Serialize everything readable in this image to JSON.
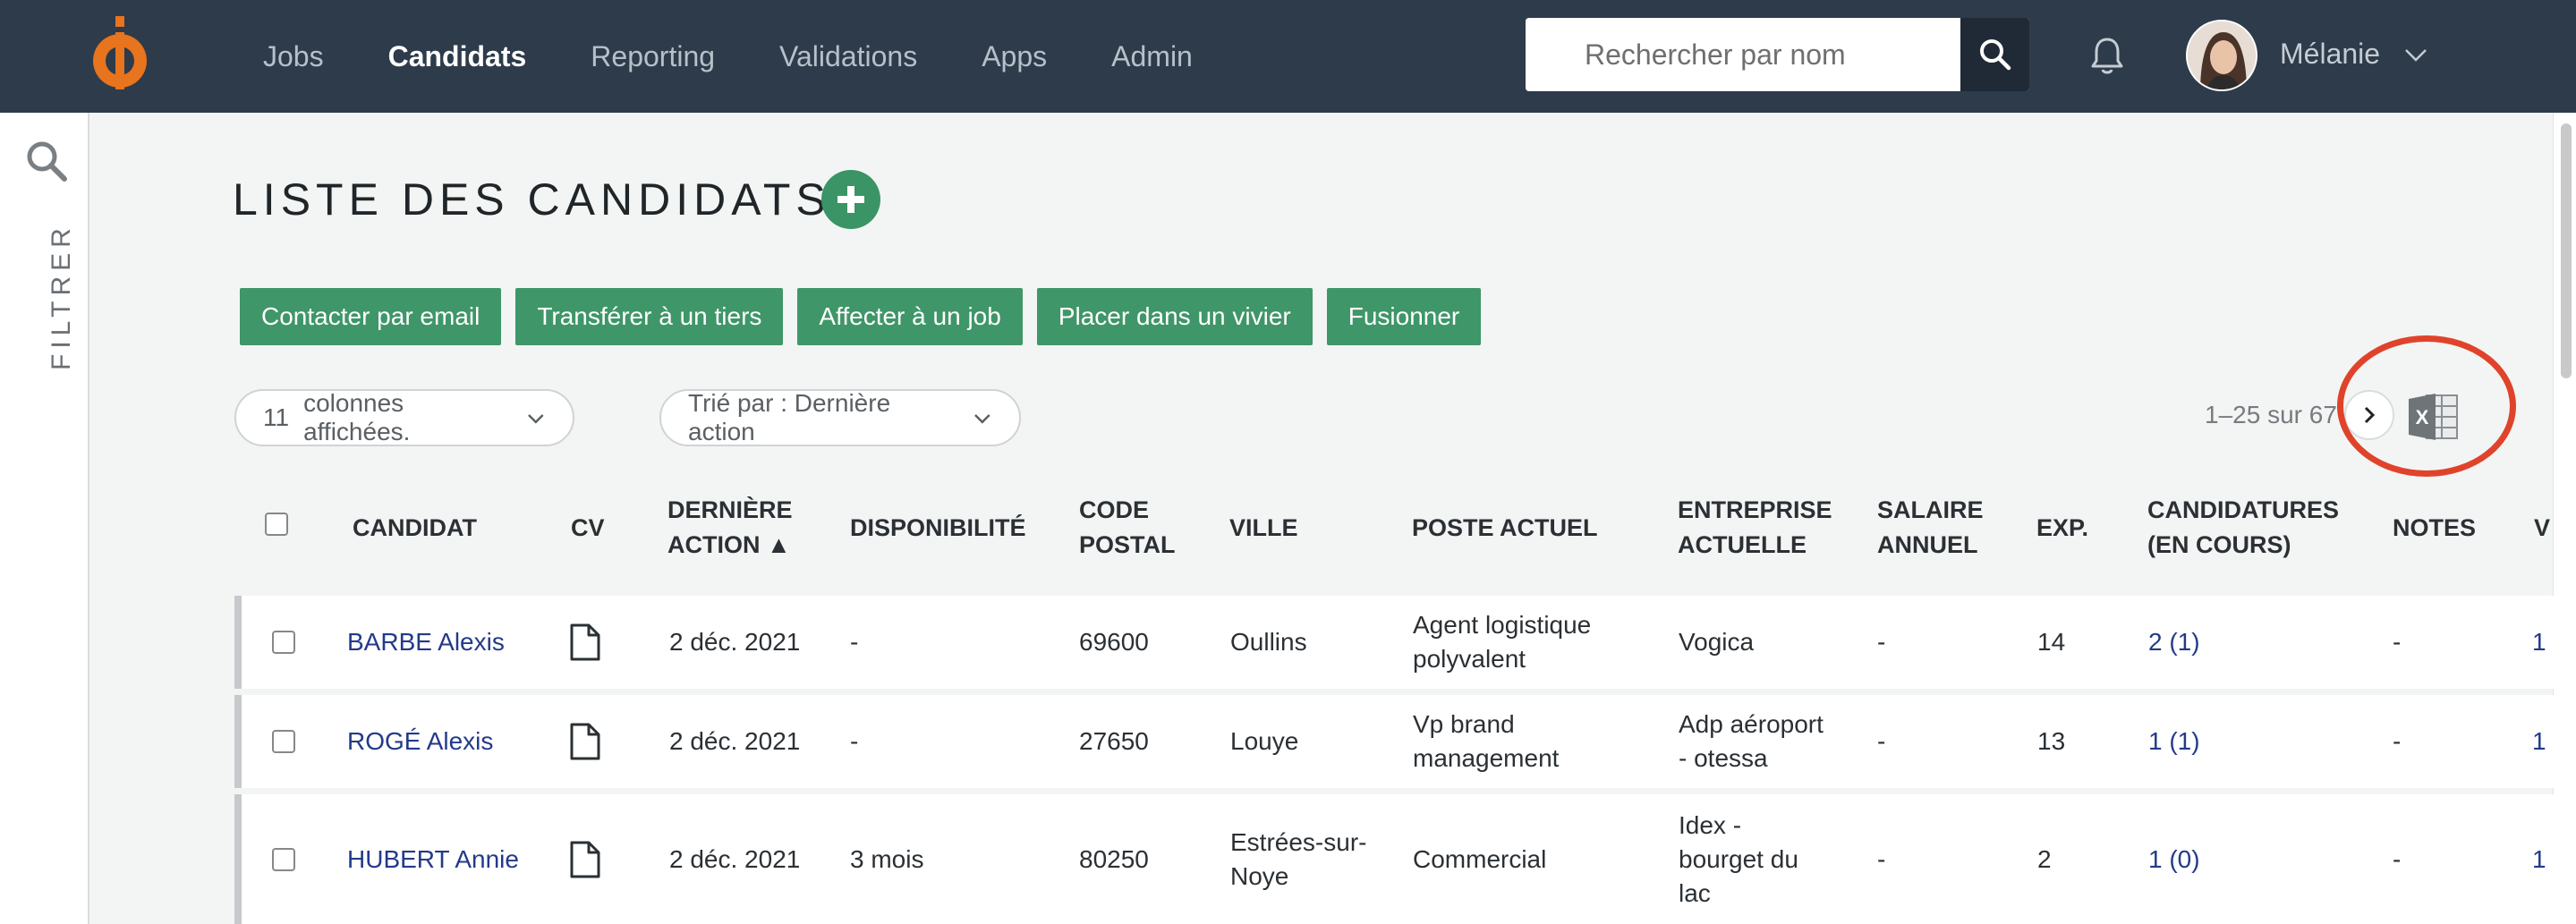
{
  "nav": {
    "items": [
      "Jobs",
      "Candidats",
      "Reporting",
      "Validations",
      "Apps",
      "Admin"
    ],
    "active": "Candidats"
  },
  "search": {
    "placeholder": "Rechercher par nom"
  },
  "user": {
    "name": "Mélanie"
  },
  "filter": {
    "label": "FILTRER"
  },
  "page": {
    "title": "LISTE DES CANDIDATS"
  },
  "actions": [
    "Contacter par email",
    "Transférer à un tiers",
    "Affecter à un job",
    "Placer dans un vivier",
    "Fusionner"
  ],
  "toolbar": {
    "columns_count": "11",
    "columns_label": "colonnes affichées.",
    "sort_label": "Trié par : Dernière action",
    "pagination": "1–25 sur 67"
  },
  "table": {
    "headers": {
      "candidat": "CANDIDAT",
      "cv": "CV",
      "derniere_1": "DERNIÈRE",
      "derniere_2": "ACTION ▲",
      "disponibilite": "DISPONIBILITÉ",
      "code_1": "CODE",
      "code_2": "POSTAL",
      "ville": "VILLE",
      "poste": "POSTE ACTUEL",
      "entreprise_1": "ENTREPRISE",
      "entreprise_2": "ACTUELLE",
      "salaire_1": "SALAIRE",
      "salaire_2": "ANNUEL",
      "exp": "EXP.",
      "candidatures_1": "CANDIDATURES",
      "candidatures_2": "(EN COURS)",
      "notes": "NOTES",
      "v": "V"
    },
    "rows": [
      {
        "candidat": "BARBE Alexis",
        "derniere": "2 déc. 2021",
        "dispo": "-",
        "code": "69600",
        "ville_1": "Oullins",
        "ville_2": "",
        "poste_1": "Agent logistique",
        "poste_2": "polyvalent",
        "entreprise_1": "Vogica",
        "entreprise_2": "",
        "entreprise_3": "",
        "salaire": "-",
        "exp": "14",
        "candidatures": "2 (1)",
        "notes": "-",
        "v": "1"
      },
      {
        "candidat": "ROGÉ Alexis",
        "derniere": "2 déc. 2021",
        "dispo": "-",
        "code": "27650",
        "ville_1": "Louye",
        "ville_2": "",
        "poste_1": "Vp brand",
        "poste_2": "management",
        "entreprise_1": "Adp aéroport",
        "entreprise_2": "- otessa",
        "entreprise_3": "",
        "salaire": "-",
        "exp": "13",
        "candidatures": "1 (1)",
        "notes": "-",
        "v": "1"
      },
      {
        "candidat": "HUBERT Annie",
        "derniere": "2 déc. 2021",
        "dispo": "3 mois",
        "code": "80250",
        "ville_1": "Estrées-sur-",
        "ville_2": "Noye",
        "poste_1": "Commercial",
        "poste_2": "",
        "entreprise_1": "Idex -",
        "entreprise_2": "bourget du",
        "entreprise_3": "lac",
        "salaire": "-",
        "exp": "2",
        "candidatures": "1 (0)",
        "notes": "-",
        "v": "1"
      }
    ]
  },
  "colors": {
    "topbar": "#2d3b4a",
    "accent_green": "#3f9669",
    "logo_orange": "#e8741e",
    "link_blue": "#233a8a",
    "annotation_red": "#e0432b"
  }
}
